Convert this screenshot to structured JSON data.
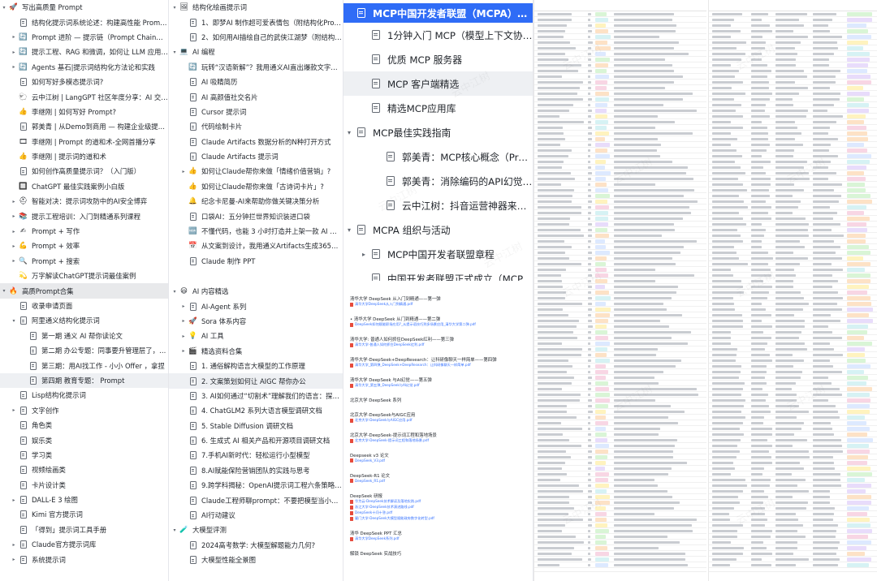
{
  "panel_a": [
    {
      "label": "写出高质量 Prompt",
      "icon": "🚀",
      "twisty": "▾",
      "level": 0
    },
    {
      "label": "结构化提示词系统论述：构建高性能 Prompt 之路",
      "icon": "doc",
      "twisty": "",
      "level": 1
    },
    {
      "label": "Prompt 进阶 — 提示链（Prompt Chain）和多提...",
      "icon": "🔄",
      "twisty": "▸",
      "level": 1
    },
    {
      "label": "提示工程、RAG 和微调，如何让 LLM 应用性能最...",
      "icon": "🔄",
      "twisty": "▸",
      "level": 1
    },
    {
      "label": "Agents 基石|提示词结构化方法论和实践",
      "icon": "🔄",
      "twisty": "▸",
      "level": 1
    },
    {
      "label": "如何写好多模态提示词?",
      "icon": "doc",
      "twisty": "",
      "level": 1
    },
    {
      "label": "云中江树 | LangGPT 社区年度分享：AI 交流的艺术",
      "icon": "🐑",
      "twisty": "",
      "level": 1
    },
    {
      "label": "李继刚 | 如何写好 Prompt?",
      "icon": "👍",
      "twisty": "",
      "level": 1
    },
    {
      "label": "郭美青 | 从Demo到商用 — 构建企业级提示词工程...",
      "icon": "doc",
      "twisty": "",
      "level": 1
    },
    {
      "label": "李继刚 | Prompt 的道和术-全网首播分享",
      "icon": "🎞",
      "twisty": "",
      "level": 1
    },
    {
      "label": "李继刚 | 提示词的道和术",
      "icon": "👍",
      "twisty": "",
      "level": 1
    },
    {
      "label": "如何创作高质量提示词？（入门版）",
      "icon": "doc",
      "twisty": "",
      "level": 1
    },
    {
      "label": "ChatGPT 最佳实践案例小白版",
      "icon": "🔲",
      "twisty": "",
      "level": 1
    },
    {
      "label": "智能对决：提示词攻防中的AI安全博弈",
      "icon": "⛑",
      "twisty": "▸",
      "level": 1
    },
    {
      "label": "提示工程培训：入门到精通系列课程",
      "icon": "📚",
      "twisty": "▸",
      "level": 1
    },
    {
      "label": "Prompt + 写作",
      "icon": "✍",
      "twisty": "▸",
      "level": 1
    },
    {
      "label": "Prompt + 效率",
      "icon": "💪",
      "twisty": "▸",
      "level": 1
    },
    {
      "label": "Prompt + 搜索",
      "icon": "🔍",
      "twisty": "▸",
      "level": 1
    },
    {
      "label": "万字解读ChatGPT提示词最佳案例",
      "icon": "💫",
      "twisty": "",
      "level": 1
    },
    {
      "label": "高质Prompt合集",
      "icon": "🔥",
      "twisty": "▾",
      "level": 0,
      "selected": true
    },
    {
      "label": "收录申请页面",
      "icon": "doc",
      "twisty": "",
      "level": 1
    },
    {
      "label": "阿里通义结构化提示词",
      "icon": "doc",
      "twisty": "▾",
      "level": 1
    },
    {
      "label": "第一期 通义 AI 帮你读论文",
      "icon": "doc",
      "twisty": "",
      "level": 2
    },
    {
      "label": "第二期 办公专题：同事要升管理层了，只管我...",
      "icon": "doc",
      "twisty": "",
      "level": 2
    },
    {
      "label": "第三期：用AI找工作 - 小小 Offer ，拿捏",
      "icon": "doc",
      "twisty": "",
      "level": 2
    },
    {
      "label": "第四期 教育专题： Prompt",
      "icon": "doc",
      "twisty": "",
      "level": 2,
      "highlight": true
    },
    {
      "label": "Lisp结构化提示词",
      "icon": "doc",
      "twisty": "",
      "level": 1
    },
    {
      "label": "文字创作",
      "icon": "doc",
      "twisty": "▸",
      "level": 1
    },
    {
      "label": "角色类",
      "icon": "doc",
      "twisty": "",
      "level": 1
    },
    {
      "label": "娱乐类",
      "icon": "doc",
      "twisty": "",
      "level": 1
    },
    {
      "label": "学习类",
      "icon": "doc",
      "twisty": "",
      "level": 1
    },
    {
      "label": "视频绘画类",
      "icon": "doc",
      "twisty": "",
      "level": 1
    },
    {
      "label": "卡片设计类",
      "icon": "doc",
      "twisty": "",
      "level": 1
    },
    {
      "label": "DALL-E 3 绘图",
      "icon": "doc",
      "twisty": "▸",
      "level": 1
    },
    {
      "label": "Kimi 官方提示词",
      "icon": "doc",
      "twisty": "",
      "level": 1
    },
    {
      "label": "「得到」提示词工具手册",
      "icon": "doc",
      "twisty": "",
      "level": 1
    },
    {
      "label": "Claude官方提示词库",
      "icon": "doc",
      "twisty": "▸",
      "level": 1
    },
    {
      "label": "系统提示词",
      "icon": "doc",
      "twisty": "▸",
      "level": 1
    }
  ],
  "panel_b1": [
    {
      "label": "结构化绘画提示词",
      "icon": "🖼",
      "twisty": "▾",
      "level": 0
    },
    {
      "label": "1、即梦AI 制作超可爱表情包（附结构化Prompt）",
      "icon": "doc",
      "twisty": "",
      "level": 1
    },
    {
      "label": "2、如何用AI描绘自己的武侠江湖梦（附结构化pr...",
      "icon": "doc",
      "twisty": "",
      "level": 1
    },
    {
      "label": "AI 编程",
      "icon": "💻",
      "twisty": "▾",
      "level": 0
    },
    {
      "label": "玩转“汉语新解”？我用通义AI直出爆款文字卡片",
      "icon": "🔄",
      "twisty": "",
      "level": 1
    },
    {
      "label": "AI 吸睛简历",
      "icon": "doc",
      "twisty": "",
      "level": 1
    },
    {
      "label": "AI 高颜值社交名片",
      "icon": "doc",
      "twisty": "",
      "level": 1
    },
    {
      "label": "Cursor 提示词",
      "icon": "doc",
      "twisty": "",
      "level": 1
    },
    {
      "label": "代码绘制卡片",
      "icon": "doc",
      "twisty": "",
      "level": 1
    },
    {
      "label": "Claude Artifacts 数据分析的N种打开方式",
      "icon": "doc",
      "twisty": "",
      "level": 1
    },
    {
      "label": "Claude Artifacts 提示词",
      "icon": "doc",
      "twisty": "",
      "level": 1
    },
    {
      "label": "如何让Claude帮你来做「情绪价值营销」?",
      "icon": "👍",
      "twisty": "▸",
      "level": 1
    },
    {
      "label": "如何让Claude帮你来做「古诗词卡片」?",
      "icon": "👍",
      "twisty": "",
      "level": 1
    },
    {
      "label": "纪念卡尼曼-AI来帮助你做关键决策分析",
      "icon": "🔔",
      "twisty": "",
      "level": 1
    },
    {
      "label": "口袋AI：五分钟拦世界知识装进口袋",
      "icon": "doc",
      "twisty": "",
      "level": 1
    },
    {
      "label": "不懂代码，也能 3 小时打造并上架一款 AI 插件",
      "icon": "🆕",
      "twisty": "",
      "level": 1
    },
    {
      "label": "从文案到设计，我用通义Artifacts生成365张灵感...",
      "icon": "📅",
      "twisty": "",
      "level": 1
    },
    {
      "label": "Claude 制作 PPT",
      "icon": "doc",
      "twisty": "",
      "level": 1
    }
  ],
  "panel_b2": [
    {
      "label": "AI 内容精选",
      "icon": "😃",
      "twisty": "▾",
      "level": 0
    },
    {
      "label": "AI-Agent 系列",
      "icon": "doc",
      "twisty": "▸",
      "level": 1
    },
    {
      "label": "Sora 体系内容",
      "icon": "🚀",
      "twisty": "▸",
      "level": 1
    },
    {
      "label": "AI 工具",
      "icon": "💡",
      "twisty": "▸",
      "level": 1
    },
    {
      "label": "精选资料合集",
      "icon": "🎬",
      "twisty": "▸",
      "level": 1
    },
    {
      "label": "1. 通俗解构语言大模型的工作原理",
      "icon": "doc",
      "twisty": "",
      "level": 1
    },
    {
      "label": "2. 文案策划如何让 AIGC 帮你办公",
      "icon": "doc",
      "twisty": "",
      "level": 1,
      "highlight": true
    },
    {
      "label": "3. AI如何通过“切割术”理解我们的语言：探索大...",
      "icon": "doc",
      "twisty": "",
      "level": 1
    },
    {
      "label": "4. ChatGLM2 系列大语言模型调研文档",
      "icon": "doc",
      "twisty": "",
      "level": 1
    },
    {
      "label": "5. Stable Diffusion 调研文档",
      "icon": "doc",
      "twisty": "",
      "level": 1
    },
    {
      "label": "6. 生成式 AI 相关产品和开源项目调研文档",
      "icon": "doc",
      "twisty": "",
      "level": 1
    },
    {
      "label": "7.手机AI新时代：轻松运行小型模型",
      "icon": "doc",
      "twisty": "",
      "level": 1
    },
    {
      "label": "8.AI赋能保险营销团队的实践与思考",
      "icon": "doc",
      "twisty": "",
      "level": 1
    },
    {
      "label": "9.跨学科揭秘：OpenAI提示词工程六条策略背后...",
      "icon": "doc",
      "twisty": "",
      "level": 1
    },
    {
      "label": "Claude工程师聊prompt：不要把模型当小孩子，...",
      "icon": "doc",
      "twisty": "",
      "level": 1
    },
    {
      "label": "AI行动建议",
      "icon": "doc",
      "twisty": "",
      "level": 1
    },
    {
      "label": "大模型评测",
      "icon": "🧪",
      "twisty": "▾",
      "level": 0
    },
    {
      "label": "2024高考数学: 大模型解题能力几何?",
      "icon": "doc",
      "twisty": "",
      "level": 1
    },
    {
      "label": "大模型性能全景图",
      "icon": "doc",
      "twisty": "",
      "level": 1
    }
  ],
  "panel_c": [
    {
      "label": "MCP中国开发者联盟（MCPA）知识库",
      "icon": "doc",
      "twisty": "",
      "level": 0,
      "title": true
    },
    {
      "label": "1分钟入门 MCP（模型上下文协议）",
      "icon": "doc",
      "twisty": "",
      "level": 1
    },
    {
      "label": "优质 MCP 服务器",
      "icon": "doc",
      "twisty": "",
      "level": 1
    },
    {
      "label": "MCP 客户端精选",
      "icon": "doc",
      "twisty": "",
      "level": 1,
      "highlight": true
    },
    {
      "label": "精选MCP应用库",
      "icon": "doc",
      "twisty": "",
      "level": 1
    },
    {
      "label": "MCP最佳实践指南",
      "icon": "doc",
      "twisty": "▾",
      "level": 0
    },
    {
      "label": "郭美青：MCP核心概念（Prompt...",
      "icon": "doc",
      "twisty": "",
      "level": 2
    },
    {
      "label": "郭美青：消除编码的API幻觉：Co...",
      "icon": "doc",
      "twisty": "",
      "level": 2
    },
    {
      "label": "云中江树：抖音运营神器来了！我...",
      "icon": "doc",
      "twisty": "",
      "level": 2
    },
    {
      "label": "MCPA 组织与活动",
      "icon": "doc",
      "twisty": "▾",
      "level": 0
    },
    {
      "label": "MCP中国开发者联盟章程",
      "icon": "doc",
      "twisty": "▸",
      "level": 1
    },
    {
      "label": "中国开发者联盟正式成立（MCPA）",
      "icon": "doc",
      "twisty": "",
      "level": 1
    }
  ],
  "panel_d": [
    {
      "kind": "h",
      "text": "清华大学 DeepSeek 从入门到精通——第一弹"
    },
    {
      "kind": "f",
      "text": "清华大学DeepSeek从入门到精通.pdf"
    },
    {
      "kind": "h",
      "text": "• 清华大学 DeepSeek 从门到精通——第二弹"
    },
    {
      "kind": "f",
      "text": "DeepSeek如何赋能职场应用?_从提示语技巧到多场景应用_清华大学第二弹.pdf"
    },
    {
      "kind": "h",
      "text": "清华大学: 普通人如何抓住DeepSeek红利——第三弹"
    },
    {
      "kind": "f",
      "text": "清华大学-普通人如何抓住DeepSeek红利.pdf"
    },
    {
      "kind": "h",
      "text": "清华大学-DeepSeek+DeepResearch：让科研像聊天一样简单——第四弹"
    },
    {
      "kind": "f",
      "text": "清华大学_第四弹_DeepSeek+DeepResearch：让科研像聊天一样简单.pdf"
    },
    {
      "kind": "h",
      "text": "清华大学 DeepSeek 与AI幻觉——第五弹"
    },
    {
      "kind": "f",
      "text": "清华大学_第五弹_DeepSeek与AI幻觉.pdf"
    },
    {
      "kind": "h",
      "text": "北京大学 DeepSeek 系列"
    },
    {
      "kind": "h",
      "text": "北京大学-DeepSeek与AIGC应用"
    },
    {
      "kind": "f",
      "text": "北京大学-DeepSeek与AIGC应用.pdf"
    },
    {
      "kind": "h",
      "text": "北京大学-DeepSeek-提示词工程和落地场景"
    },
    {
      "kind": "f",
      "text": "北京大学-DeepSeek-提示词工程和落地场景.pdf"
    },
    {
      "kind": "h",
      "text": "Deepseek v3 论文"
    },
    {
      "kind": "f",
      "text": "DeepSeek_V3.pdf"
    },
    {
      "kind": "h",
      "text": "DeepSeek-R1 论文"
    },
    {
      "kind": "f",
      "text": "DeepSeek_R1.pdf"
    },
    {
      "kind": "h",
      "text": "DeepSeek 研报"
    },
    {
      "kind": "f",
      "text": "华为云-DeepSeek技术解读及落地实践.pdf"
    },
    {
      "kind": "f",
      "text": "浙江大学-DeepSeek技术演进路线.pdf"
    },
    {
      "kind": "f",
      "text": "DeepSeek十问十答.pdf"
    },
    {
      "kind": "f",
      "text": "厦门大学-DeepSeek大模型赋能政府数字化转型.pdf"
    },
    {
      "kind": "h",
      "text": "清华 DeepSeek PPT 汇总"
    },
    {
      "kind": "f",
      "text": "清华大学DeepSeek系列.pdf"
    },
    {
      "kind": "h",
      "text": "解锁 DeepSeek 实战技巧"
    }
  ],
  "watermark_text": "云中江树",
  "colors": {
    "accent": "#2f6cf6",
    "selected_row": "#e8e9eb",
    "link": "#3370ff",
    "text": "#1f2329"
  }
}
